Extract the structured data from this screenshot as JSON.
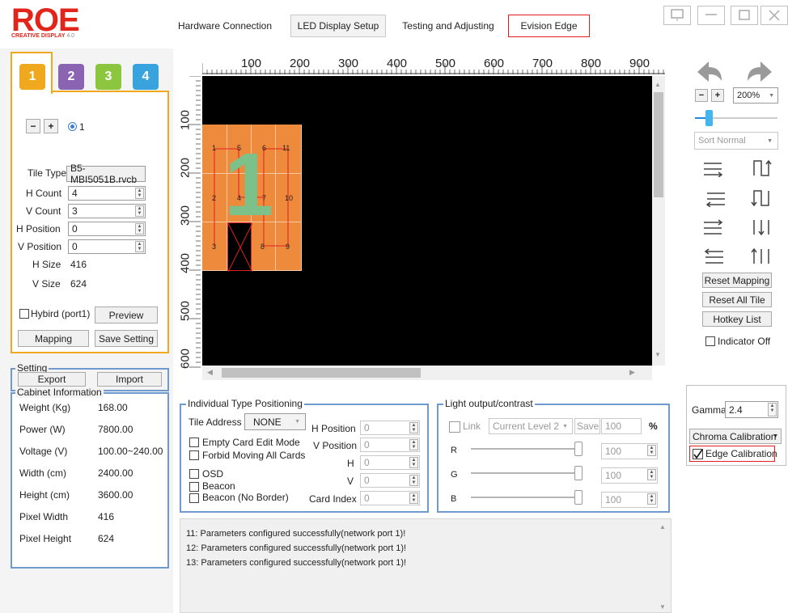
{
  "brand": {
    "logo": "ROE",
    "sub": "CREATIVE DISPLAY",
    "ver": "4.0"
  },
  "tabs": [
    {
      "label": "Hardware Connection"
    },
    {
      "label": "LED Display Setup"
    },
    {
      "label": "Testing and Adjusting"
    },
    {
      "label": "Evision Edge"
    }
  ],
  "port_tabs": [
    {
      "label": "1",
      "color": "#f0a81f"
    },
    {
      "label": "2",
      "color": "#8a64b3"
    },
    {
      "label": "3",
      "color": "#8cc63f"
    },
    {
      "label": "4",
      "color": "#39a3dd"
    }
  ],
  "left": {
    "minus": "−",
    "plus": "+",
    "radio_label": "1",
    "tile_type_label": "Tile Type",
    "tile_type_value": "B5-MBI5051B.rvcb",
    "h_count_label": "H Count",
    "h_count_value": "4",
    "v_count_label": "V Count",
    "v_count_value": "3",
    "h_position_label": "H Position",
    "h_position_value": "0",
    "v_position_label": "V Position",
    "v_position_value": "0",
    "h_size_label": "H Size",
    "h_size_value": "416",
    "v_size_label": "V Size",
    "v_size_value": "624",
    "hybird_label": "Hybird (port1)",
    "preview": "Preview",
    "mapping": "Mapping",
    "save_setting": "Save Setting"
  },
  "setting": {
    "title": "Setting",
    "export": "Export",
    "import": "Import"
  },
  "cabinet": {
    "title": "Cabinet Information",
    "rows": [
      {
        "label": "Weight (Kg)",
        "value": "168.00"
      },
      {
        "label": "Power (W)",
        "value": "7800.00"
      },
      {
        "label": "Voltage (V)",
        "value": "100.00~240.00"
      },
      {
        "label": "Width (cm)",
        "value": "2400.00"
      },
      {
        "label": "Height (cm)",
        "value": "3600.00"
      },
      {
        "label": "Pixel Width",
        "value": "416"
      },
      {
        "label": "Pixel Height",
        "value": "624"
      }
    ]
  },
  "ruler": {
    "h": [
      "100",
      "200",
      "300",
      "400",
      "500",
      "600",
      "700",
      "800",
      "900"
    ],
    "v": [
      "100",
      "200",
      "300",
      "400",
      "500",
      "600"
    ]
  },
  "canvas": {
    "big_number": "1",
    "tile_labels": [
      "1",
      "5",
      "6",
      "11",
      "2",
      "4",
      "7",
      "10",
      "3",
      "8",
      "9"
    ]
  },
  "right": {
    "zoom": "200%",
    "sort": "Sort Normal",
    "reset_mapping": "Reset Mapping",
    "reset_all_tile": "Reset All Tile",
    "hotkey_list": "Hotkey List",
    "indicator_off": "Indicator Off",
    "gamma_label": "Gamma",
    "gamma_value": "2.4",
    "chroma": "Chroma Calibration",
    "edge": "Edge Calibration"
  },
  "itp": {
    "title": "Individual Type Positioning",
    "tile_address_label": "Tile Address",
    "tile_address_value": "NONE",
    "empty_card": "Empty Card Edit Mode",
    "forbid": "Forbid Moving All Cards",
    "osd": "OSD",
    "beacon": "Beacon",
    "beacon_nb": "Beacon (No Border)",
    "h_position": "H Position",
    "v_position": "V Position",
    "h": "H",
    "v": "V",
    "card_index": "Card Index",
    "h_position_value": "0",
    "v_position_value": "0",
    "h_value": "0",
    "v_value": "0",
    "card_index_value": "0"
  },
  "light": {
    "title": "Light output/contrast",
    "link": "Link",
    "level": "Current Level 2",
    "save": "Save",
    "value": "100",
    "percent": "%",
    "r": "R",
    "g": "G",
    "b": "B",
    "r_value": "100",
    "g_value": "100",
    "b_value": "100"
  },
  "log": [
    "11: Parameters configured successfully(network port 1)!",
    "12: Parameters configured successfully(network port 1)!",
    "13: Parameters configured successfully(network port 1)!"
  ]
}
